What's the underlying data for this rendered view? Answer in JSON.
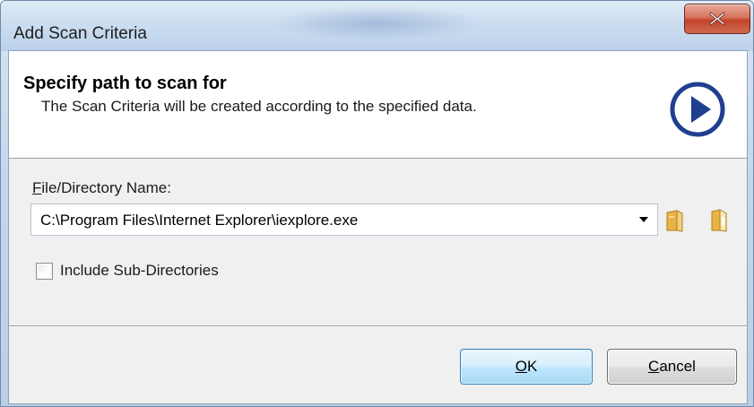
{
  "window": {
    "title": "Add Scan Criteria",
    "close_icon": "close-x-icon"
  },
  "header": {
    "title": "Specify path to scan for",
    "description": "The Scan Criteria will be created according to the specified data.",
    "icon": "play-circle-icon"
  },
  "form": {
    "path_label_mnemonic": "F",
    "path_label_rest": "ile/Directory Name:",
    "path_value": "C:\\Program Files\\Internet Explorer\\iexplore.exe",
    "browse_file_icon": "folder-icon",
    "browse_directory_icon": "folder-open-icon",
    "include_subdirs_label": "Include Sub-Directories",
    "include_subdirs_checked": false
  },
  "buttons": {
    "ok_mnemonic": "O",
    "ok_rest": "K",
    "cancel_mnemonic": "C",
    "cancel_rest": "ancel"
  },
  "colors": {
    "accent": "#1f3f8f",
    "folder": "#e8b448"
  }
}
